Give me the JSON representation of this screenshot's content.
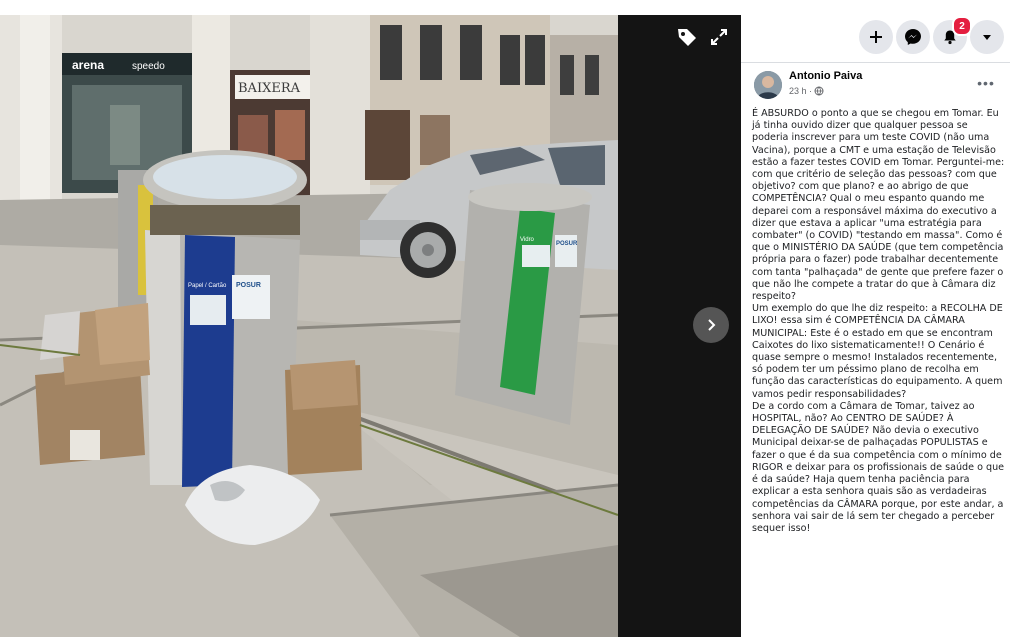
{
  "viewer": {
    "tag_icon": "tag-icon",
    "fullscreen_icon": "expand-icon",
    "next_icon": "chevron-right-icon"
  },
  "photo": {
    "shop_signs": [
      "arena",
      "speedo",
      "BAIXERA"
    ],
    "bin_labels": [
      "Papel / Cartão",
      "Vidro"
    ],
    "bin_brand": "POSUR"
  },
  "top_actions": {
    "create_icon": "plus-icon",
    "messenger_icon": "messenger-icon",
    "notifications_icon": "bell-icon",
    "notifications_count": "2",
    "account_icon": "caret-down-icon"
  },
  "post": {
    "author": "Antonio Paiva",
    "time": "23 h ·",
    "audience_icon": "globe-icon",
    "paragraphs": [
      "É ABSURDO o ponto a que se chegou em Tomar. Eu já tinha ouvido dizer que qualquer pessoa se poderia inscrever para um teste COVID (não uma Vacina), porque a CMT e uma estação de Televisão estão a fazer testes COVID em Tomar. Perguntei-me: com que critério de seleção das pessoas? com que objetivo? com que plano? e ao abrigo de que COMPETÊNCIA? Qual o meu espanto quando me deparei com a responsável máxima do executivo a dizer que estava a aplicar \"uma estratégia para combater\" (o COVID) \"testando em massa\". Como é que o MINISTÉRIO DA SAÚDE (que tem competência própria para o fazer) pode trabalhar decentemente com tanta \"palhaçada\" de gente que prefere fazer o que não lhe compete a tratar do que à Câmara diz respeito?",
      "Um exemplo do que lhe diz respeito: a RECOLHA DE LIXO! essa sim é COMPETÊNCIA DA CÂMARA MUNICIPAL: Este é o estado em que se encontram Caixotes do lixo sistematicamente!! O Cenário é quase sempre o mesmo! Instalados recentemente, só podem ter um péssimo plano de recolha em função das características do equipamento. A quem vamos pedir responsabilidades?",
      "De a cordo com a Câmara de Tomar, taivez ao HOSPITAL, não? Ao CENTRO DE SAÚDE? À DELEGAÇÃO DE SAÚDE? Não devia o executivo Municipal deixar-se de palhaçadas POPULISTAS e fazer o que é da sua competência com o mínimo de RIGOR e deixar para os profissionais de saúde o que é da saúde? Haja quem tenha paciência para explicar a esta senhora quais são as verdadeiras competências da CÂMARA porque, por este andar, a senhora vai sair de lá sem ter chegado a perceber sequer isso!"
    ]
  }
}
